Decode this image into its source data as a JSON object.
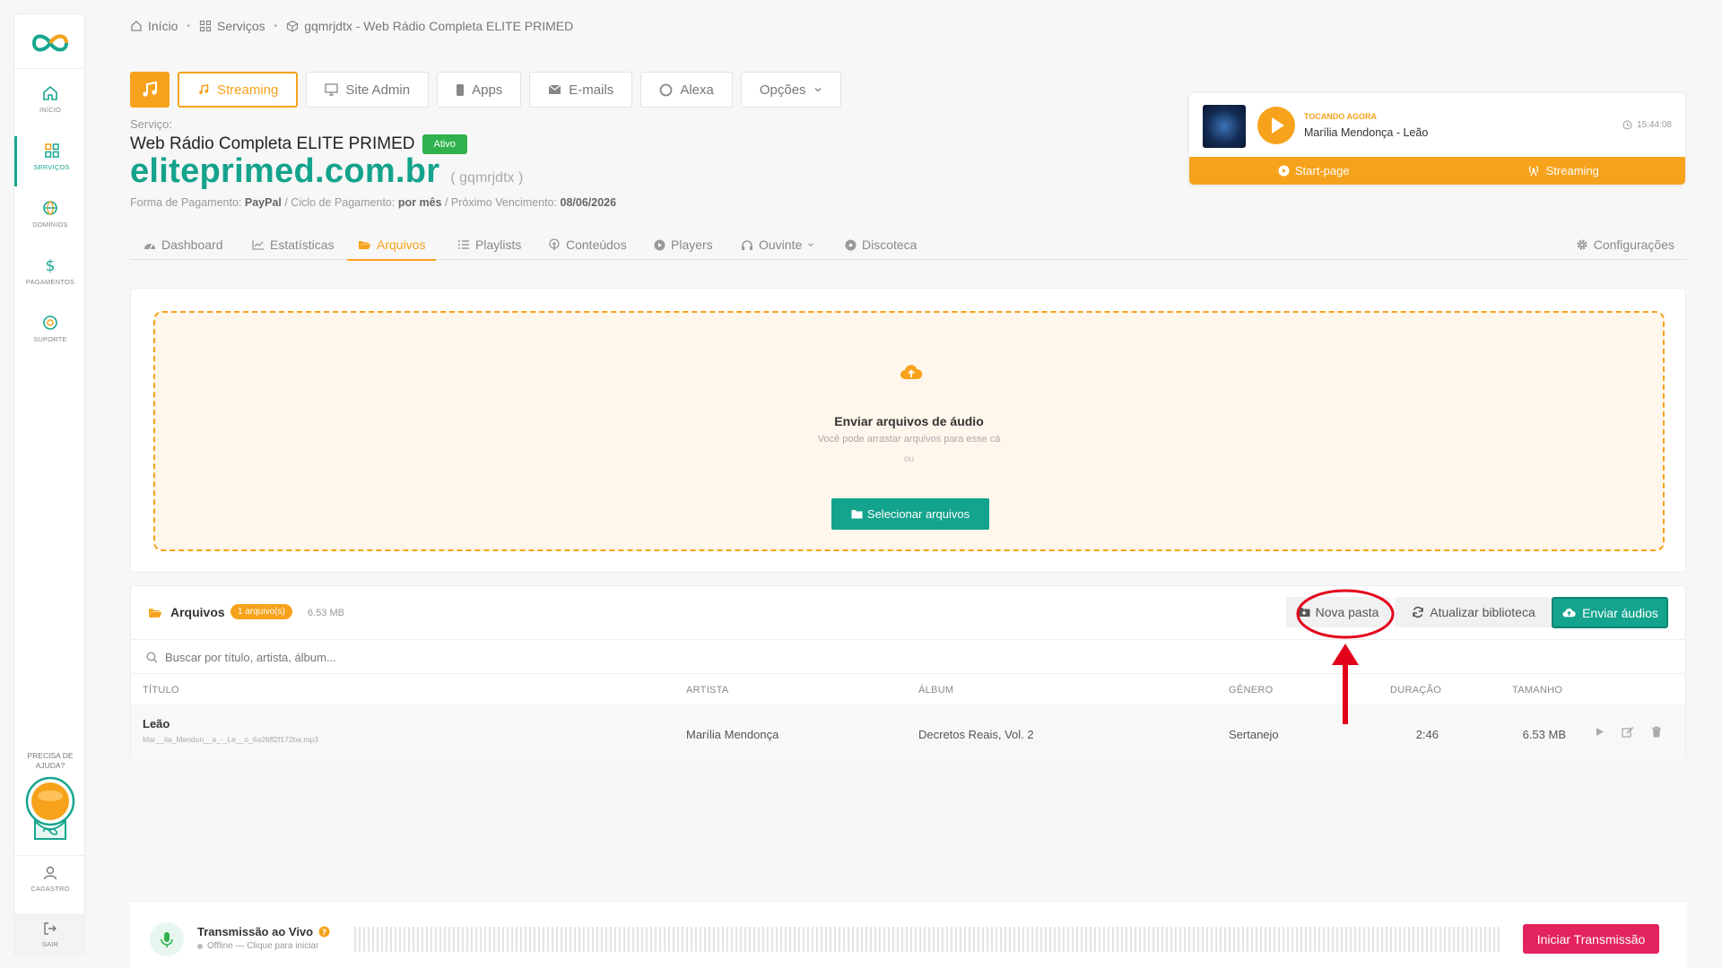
{
  "sidebar": {
    "items": [
      {
        "label": "Início",
        "icon": "home-icon"
      },
      {
        "label": "Serviços",
        "icon": "grid-icon",
        "active": true
      },
      {
        "label": "Domínios",
        "icon": "globe-icon"
      },
      {
        "label": "Pagamentos",
        "icon": "dollar-icon"
      },
      {
        "label": "Suporte",
        "icon": "lifebuoy-icon"
      }
    ],
    "help": "Precisa de ajuda?",
    "cadastro": "Cadastro",
    "sair": "Sair"
  },
  "breadcrumb": [
    "Início",
    "Serviços",
    "gqmrjdtx - Web Rádio Completa ELITE PRIMED"
  ],
  "service_nav": {
    "items": [
      "Streaming",
      "Site Admin",
      "Apps",
      "E-mails",
      "Alexa",
      "Opções"
    ],
    "active": "Streaming"
  },
  "service": {
    "label": "Serviço:",
    "name": "Web Rádio Completa ELITE PRIMED",
    "status": "Ativo",
    "domain": "eliteprimed.com.br",
    "username": "( gqmrjdtx )",
    "payment_label": "Forma de Pagamento:",
    "payment": "PayPal",
    "cycle_label": "/ Ciclo de Pagamento:",
    "cycle": "por mês",
    "due_label": "/ Próximo Vencimento:",
    "due": "08/06/2026"
  },
  "now_playing": {
    "label": "Tocando agora",
    "track": "Marília Mendonça - Leão",
    "time": "15:44:08",
    "links": [
      "Start-page",
      "Streaming"
    ]
  },
  "tabs": [
    "Dashboard",
    "Estatísticas",
    "Arquivos",
    "Playlists",
    "Conteúdos",
    "Players",
    "Ouvinte",
    "Discoteca",
    "Configurações"
  ],
  "active_tab": "Arquivos",
  "upload": {
    "title": "Enviar arquivos de áudio",
    "hint": "Você pode arrastar arquivos para esse cá",
    "or": "ou",
    "button": "Selecionar arquivos"
  },
  "files": {
    "title": "Arquivos",
    "count": "1 arquivo(s)",
    "size": "6.53 MB",
    "buttons": {
      "new_folder": "Nova pasta",
      "refresh": "Atualizar biblioteca",
      "send": "Enviar áudios"
    },
    "search_placeholder": "Buscar por título, artista, álbum...",
    "columns": [
      "Título",
      "Artista",
      "Álbum",
      "Gênero",
      "Duração",
      "Tamanho"
    ],
    "rows": [
      {
        "title": "Leão",
        "file": "Mar__lia_Mendon__a_-_Le__o_6a26ff2f172ba.mp3",
        "artist": "Marília Mendonça",
        "album": "Decretos Reais, Vol. 2",
        "genre": "Sertanejo",
        "duration": "2:46",
        "size": "6.53 MB"
      }
    ]
  },
  "live": {
    "title": "Transmissão ao Vivo",
    "status": "Offline — Clique para iniciar",
    "button": "Iniciar Transmissão"
  },
  "colors": {
    "accent": "#f7a21b",
    "brand": "#14a38c",
    "active_badge": "#2fb24d",
    "danger": "#e2235d",
    "annotation": "#e3001b"
  }
}
